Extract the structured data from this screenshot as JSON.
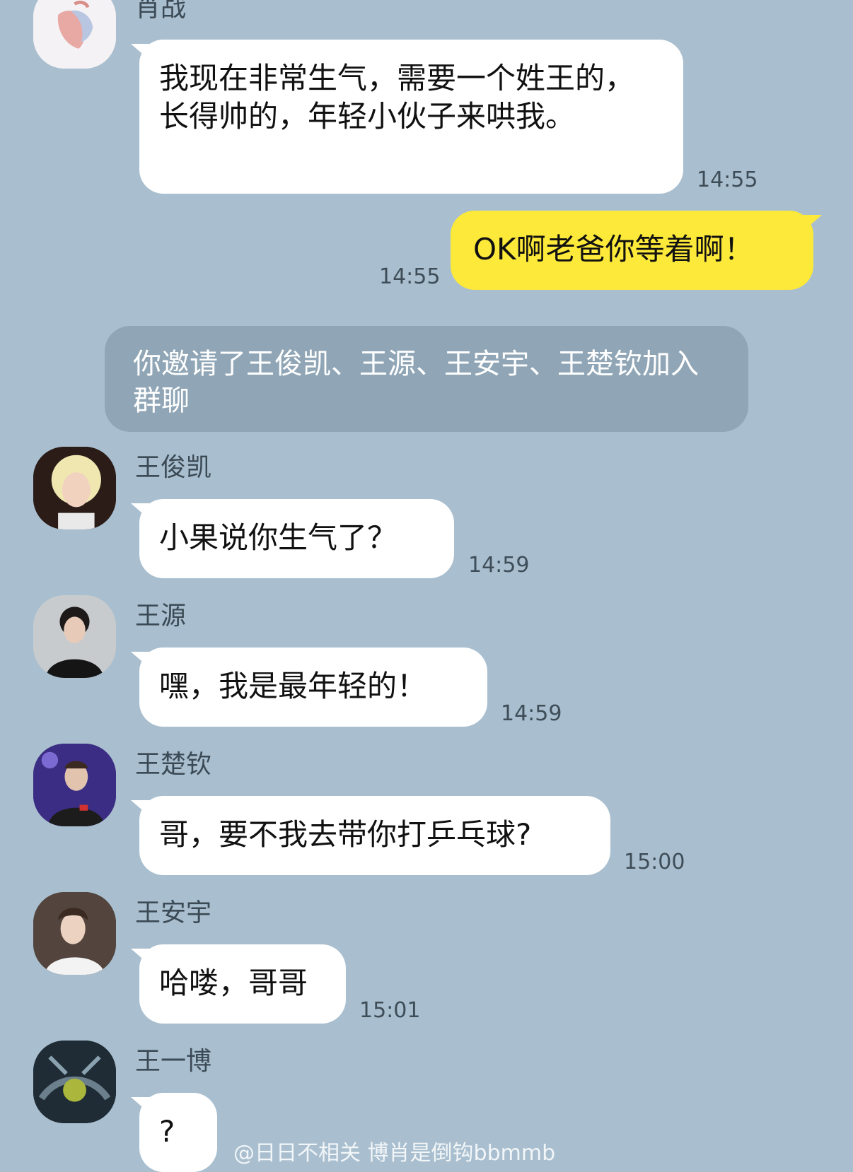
{
  "colors": {
    "background": "#a9bfcf",
    "incoming_bubble": "#ffffff",
    "outgoing_bubble": "#fde93a",
    "system_notice": "#90a6b6"
  },
  "messages": [
    {
      "sender": "肖战",
      "avatar_icon": "heart-artwork-avatar-icon",
      "text": "我现在非常生气，需要一个姓王的，长得帅的，年轻小伙子来哄我。",
      "time": "14:55"
    },
    {
      "sender": "",
      "direction": "outgoing",
      "text": "OK啊老爸你等着啊！",
      "time": "14:55"
    },
    {
      "sender": "王俊凯",
      "avatar_icon": "profile-photo-icon",
      "text": "小果说你生气了？",
      "time": "14:59"
    },
    {
      "sender": "王源",
      "avatar_icon": "profile-photo-icon",
      "text": "嘿，我是最年轻的！",
      "time": "14:59"
    },
    {
      "sender": "王楚钦",
      "avatar_icon": "profile-photo-icon",
      "text": "哥，要不我去带你打乒乓球?",
      "time": "15:00"
    },
    {
      "sender": "王安宇",
      "avatar_icon": "profile-photo-icon",
      "text": "哈喽，哥哥",
      "time": "15:01"
    },
    {
      "sender": "王一博",
      "avatar_icon": "profile-photo-icon",
      "text": "?",
      "time": ""
    }
  ],
  "system_notice": "你邀请了王俊凯、王源、王安宇、王楚钦加入群聊",
  "watermark": "@日日不相关 博肖是倒钩bbmmb"
}
